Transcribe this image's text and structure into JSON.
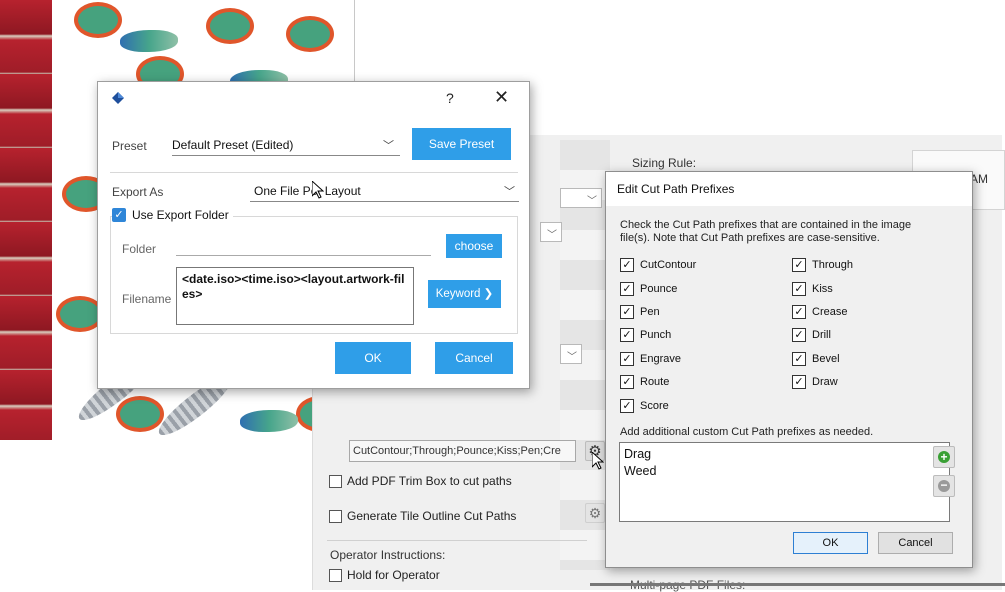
{
  "export_dialog": {
    "help_label": "?",
    "close_label": "✕",
    "preset_label": "Preset",
    "preset_value": "Default Preset (Edited)",
    "save_preset_label": "Save Preset",
    "export_as_label": "Export As",
    "export_as_value": "One File Per Layout",
    "use_export_folder_label": "Use Export Folder",
    "use_export_folder_checked": true,
    "folder_label": "Folder",
    "choose_label": "choose",
    "filename_label": "Filename",
    "filename_value": "<date.iso><time.iso><layout.artwork-files>",
    "keyword_label": "Keyword ❯",
    "ok_label": "OK",
    "cancel_label": "Cancel",
    "accent_color": "#2f9ee8"
  },
  "background_panel": {
    "sizing_rule_label": "Sizing Rule:",
    "am_label": "AM",
    "prefix_field_value": "CutContour;Through;Pounce;Kiss;Pen;Cre",
    "add_trim_box_label": "Add PDF Trim Box to cut paths",
    "generate_tile_label": "Generate Tile Outline Cut Paths",
    "operator_instructions_label": "Operator Instructions:",
    "hold_for_operator_label": "Hold for Operator",
    "multipage_label": "Multi-page PDF Files:"
  },
  "cut_dialog": {
    "title": "Edit Cut Path Prefixes",
    "description": "Check the Cut Path prefixes that are contained in the image file(s). Note that Cut Path prefixes are case-sensitive.",
    "left_prefixes": [
      {
        "label": "CutContour",
        "checked": true
      },
      {
        "label": "Pounce",
        "checked": true
      },
      {
        "label": "Pen",
        "checked": true
      },
      {
        "label": "Punch",
        "checked": true
      },
      {
        "label": "Engrave",
        "checked": true
      },
      {
        "label": "Route",
        "checked": true
      },
      {
        "label": "Score",
        "checked": true
      }
    ],
    "right_prefixes": [
      {
        "label": "Through",
        "checked": true
      },
      {
        "label": "Kiss",
        "checked": true
      },
      {
        "label": "Crease",
        "checked": true
      },
      {
        "label": "Drill",
        "checked": true
      },
      {
        "label": "Bevel",
        "checked": true
      },
      {
        "label": "Draw",
        "checked": true
      }
    ],
    "add_custom_label": "Add additional custom Cut Path prefixes as needed.",
    "custom_prefixes": [
      "Drag",
      "Weed"
    ],
    "ok_label": "OK",
    "cancel_label": "Cancel",
    "add_button_color": "#3aa035"
  }
}
